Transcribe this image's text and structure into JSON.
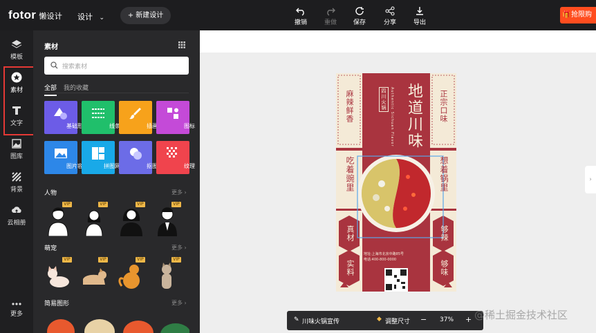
{
  "topbar": {
    "logo": "fotor",
    "logo_sub": "懒设计",
    "design_menu": "设计",
    "new_design": "+ 新建设计",
    "tools": [
      {
        "label": "撤销",
        "icon": "undo-icon",
        "enabled": true
      },
      {
        "label": "重做",
        "icon": "redo-icon",
        "enabled": false
      },
      {
        "label": "保存",
        "icon": "save-icon",
        "enabled": true
      },
      {
        "label": "分享",
        "icon": "share-icon",
        "enabled": true
      },
      {
        "label": "导出",
        "icon": "export-icon",
        "enabled": true
      }
    ],
    "promo": "抢限购"
  },
  "sidebar": {
    "items": [
      {
        "label": "模板",
        "icon": "layers-icon"
      },
      {
        "label": "素材",
        "icon": "star-icon"
      },
      {
        "label": "文字",
        "icon": "text-icon"
      },
      {
        "label": "图库",
        "icon": "image-icon"
      },
      {
        "label": "背景",
        "icon": "background-icon"
      },
      {
        "label": "云相册",
        "icon": "cloud-upload-icon"
      },
      {
        "label": "更多",
        "icon": "more-icon"
      }
    ],
    "active": "素材"
  },
  "panel": {
    "title": "素材",
    "search_placeholder": "搜索素材",
    "tabs": [
      "全部",
      "我的收藏"
    ],
    "tiles": [
      {
        "label": "基础形状",
        "color": "#6c5ce7"
      },
      {
        "label": "线条",
        "color": "#20bf6b"
      },
      {
        "label": "插画",
        "color": "#f7a21b"
      },
      {
        "label": "图标",
        "color": "#c44ad8"
      },
      {
        "label": "图片容器",
        "color": "#2d87e8"
      },
      {
        "label": "拼图网格",
        "color": "#19a9e8"
      },
      {
        "label": "抠图",
        "color": "#6c6ce7"
      },
      {
        "label": "纹理",
        "color": "#f0444d"
      }
    ],
    "sections": [
      {
        "title": "人物",
        "more": "更多 ›"
      },
      {
        "title": "萌宠",
        "more": "更多 ›"
      },
      {
        "title": "简易图形",
        "more": "更多 ›"
      }
    ],
    "vip_label": "VIP"
  },
  "poster": {
    "side_left": "麻辣鲜香",
    "side_right": "正宗口味",
    "stamp": "四川火锅",
    "title": "地道川味",
    "subtitle": "Authentic Sichuan Flavor",
    "left_banner": "吃着豌里",
    "right_banner": "想着锅里",
    "left_badges": [
      "真材",
      "实料"
    ],
    "right_badges": [
      "够辣",
      "够味"
    ],
    "address": "地址:上海市北京中路85号",
    "phone": "电话:400-800-0000"
  },
  "bottombar": {
    "doc_name": "川味火锅宣传",
    "resize": "调整尺寸",
    "zoom_minus": "−",
    "zoom": "37%",
    "zoom_plus": "+"
  },
  "watermark": "@稀土掘金技术社区",
  "colors": {
    "accent_red": "#e53935",
    "poster_red": "#a9343f",
    "poster_cream": "#f4ead7",
    "topbar_bg": "#1d1d1f",
    "panel_bg": "#29292b"
  }
}
